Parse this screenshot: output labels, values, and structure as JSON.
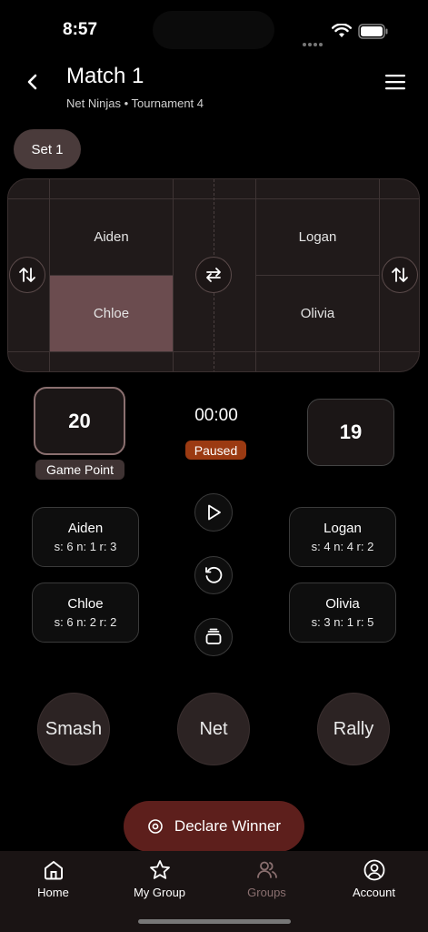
{
  "status_bar": {
    "time": "8:57"
  },
  "header": {
    "title": "Match 1",
    "subtitle": "Net Ninjas • Tournament 4"
  },
  "set_chip": "Set 1",
  "court": {
    "left_top": "Aiden",
    "left_bottom": "Chloe",
    "right_top": "Logan",
    "right_bottom": "Olivia"
  },
  "score": {
    "left": "20",
    "right": "19",
    "left_badge": "Game Point"
  },
  "timer": {
    "value": "00:00",
    "state": "Paused"
  },
  "players": [
    {
      "name": "Aiden",
      "stats": "s: 6  n: 1  r: 3"
    },
    {
      "name": "Logan",
      "stats": "s: 4  n: 4  r: 2"
    },
    {
      "name": "Chloe",
      "stats": "s: 6  n: 2  r: 2"
    },
    {
      "name": "Olivia",
      "stats": "s: 3  n: 1  r: 5"
    }
  ],
  "actions": {
    "smash": "Smash",
    "net": "Net",
    "rally": "Rally"
  },
  "declare_winner": "Declare Winner",
  "tabs": [
    {
      "label": "Home",
      "icon": "home-icon"
    },
    {
      "label": "My Group",
      "icon": "star-icon"
    },
    {
      "label": "Groups",
      "icon": "people-icon",
      "active": true
    },
    {
      "label": "Account",
      "icon": "account-icon"
    }
  ],
  "colors": {
    "selected_player": "#6b4c4f",
    "paused_badge": "#9b3a12",
    "declare_button": "#5d1f1c",
    "active_tab": "#8a6f6f"
  }
}
